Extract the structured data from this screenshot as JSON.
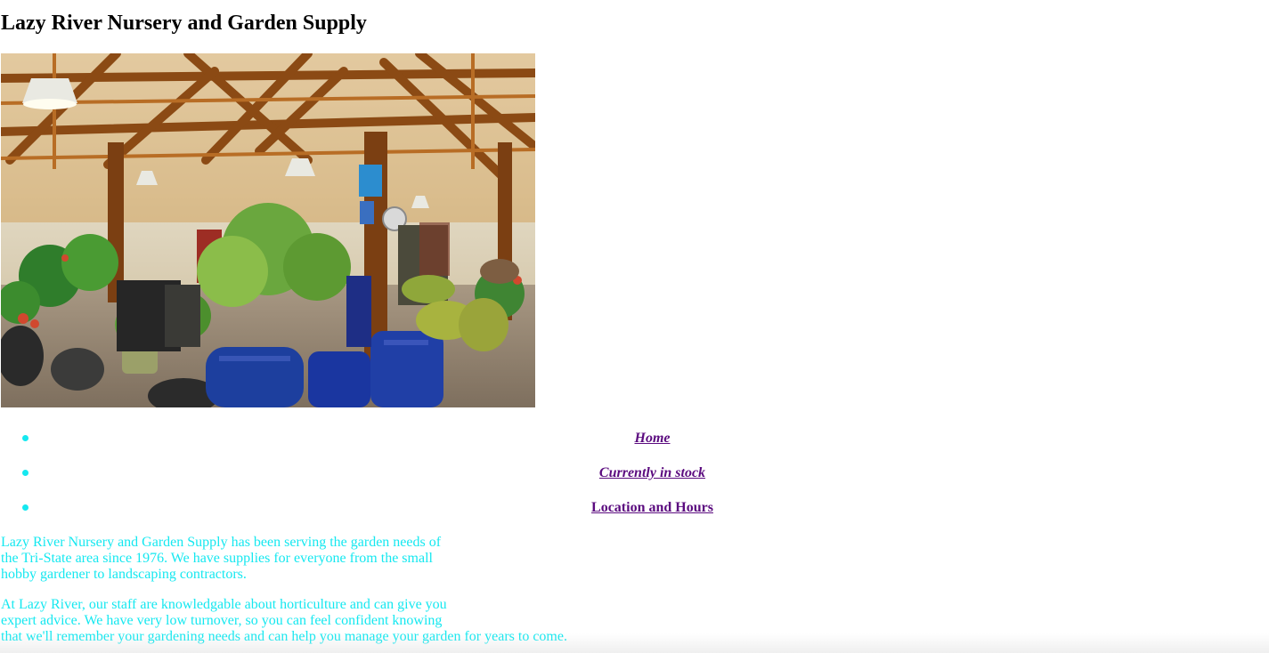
{
  "site": {
    "title": "Lazy River Nursery and Garden Supply"
  },
  "hero": {
    "description": "nursery interior with wooden beams, hanging lamps and potted plants"
  },
  "nav": {
    "items": [
      {
        "label": "Home",
        "style": "italic"
      },
      {
        "label": "Currently in stock",
        "style": "italic"
      },
      {
        "label": "Location and Hours",
        "style": "normal"
      }
    ]
  },
  "about": {
    "p1_lines": [
      "Lazy River Nursery and Garden Supply has been serving the garden needs of",
      "the Tri-State area since 1976. We have supplies for everyone from the small",
      "hobby gardener to landscaping contractors."
    ],
    "p2_lines": [
      "At Lazy River, our staff are knowledgable about horticulture and can give you",
      "expert advice. We have very low turnover, so you can feel confident knowing",
      "that we'll remember your gardening needs and can help you manage your garden for years to come."
    ]
  },
  "colors": {
    "text_cyan": "#15e8f0",
    "link_purple": "#5b0b7f",
    "heading": "#000000"
  }
}
